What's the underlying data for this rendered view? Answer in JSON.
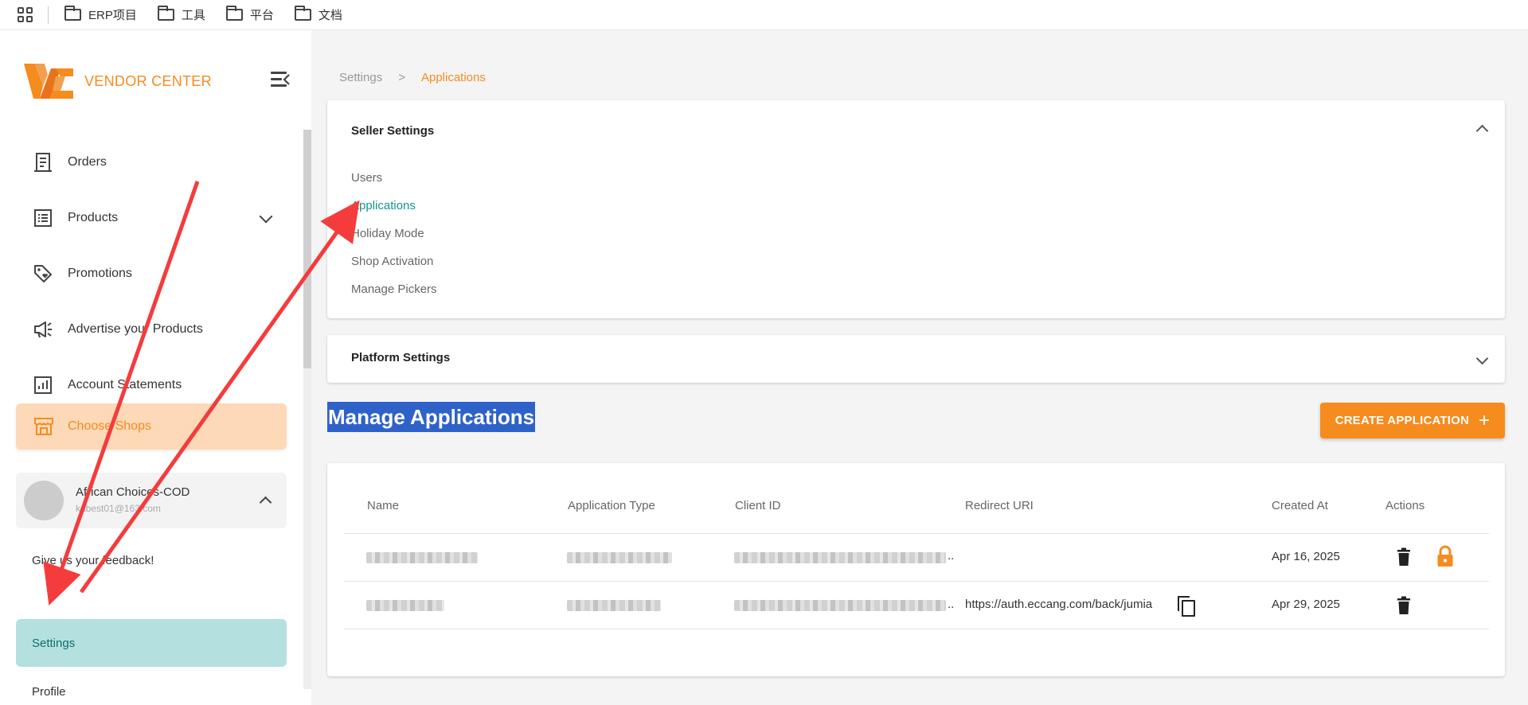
{
  "bookmarks": [
    "ERP项目",
    "工具",
    "平台",
    "文档"
  ],
  "sidebar": {
    "logo_text": "VENDOR CENTER",
    "nav": [
      {
        "label": "Orders",
        "icon": "receipt-icon"
      },
      {
        "label": "Products",
        "icon": "list-icon"
      },
      {
        "label": "Promotions",
        "icon": "tag-icon"
      },
      {
        "label": "Advertise your Products",
        "icon": "megaphone-icon"
      },
      {
        "label": "Account Statements",
        "icon": "chart-icon"
      }
    ],
    "choose_shops": "Choose Shops",
    "account_name": "African Choices-COD",
    "account_email": "kabest01@163.com",
    "feedback": "Give us your feedback!",
    "settings": "Settings",
    "profile": "Profile"
  },
  "breadcrumb": {
    "home": "Settings",
    "sep": ">",
    "current": "Applications"
  },
  "seller_settings": {
    "title": "Seller Settings",
    "links": [
      "Users",
      "Applications",
      "Holiday Mode",
      "Shop Activation",
      "Manage Pickers"
    ]
  },
  "platform_settings": {
    "title": "Platform Settings"
  },
  "main": {
    "title": "Manage Applications",
    "create_button": "CREATE APPLICATION",
    "create_plus": "+"
  },
  "table": {
    "headers": [
      "Name",
      "Application Type",
      "Client ID",
      "Redirect URI",
      "Created At",
      "Actions"
    ],
    "rows": [
      {
        "redirect_uri": "",
        "created_at": "Apr 16, 2025",
        "client_ellipsis": ".."
      },
      {
        "redirect_uri": "https://auth.eccang.com/back/jumia",
        "created_at": "Apr 29, 2025",
        "client_ellipsis": ".."
      }
    ]
  },
  "colors": {
    "accent": "#f68b1e",
    "active_teal": "#11968f",
    "settings_bg": "#b4e1df",
    "annotation_arrow": "#f43c3c"
  }
}
